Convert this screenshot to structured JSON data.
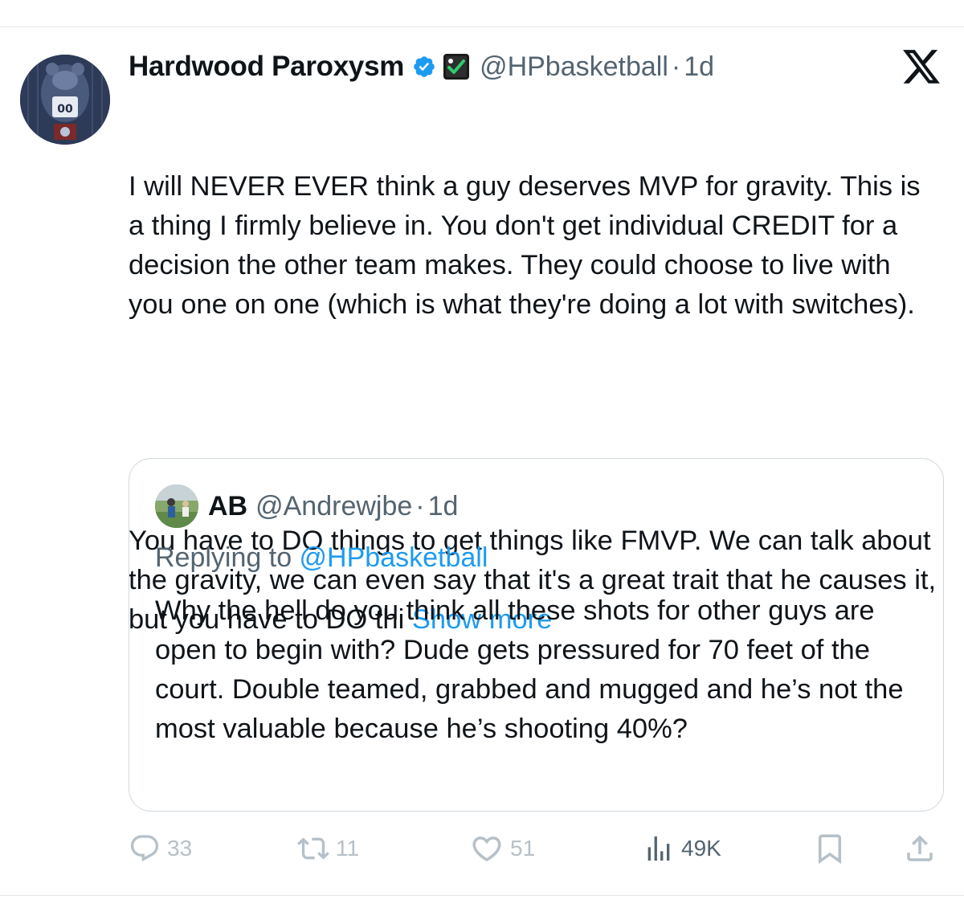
{
  "tweet": {
    "author_name": "Hardwood Paroxysm",
    "handle": "@HPbasketball",
    "separator": "·",
    "time": "1d",
    "text_paragraph_1": "I will NEVER EVER think a guy deserves MVP for gravity. This is a thing I firmly believe in. You don't get individual CREDIT for a decision the other team makes. They could choose to live with you one on one (which is what they're doing a lot with switches).",
    "text_paragraph_2": "You have to DO things to get things like FMVP. We can talk about the gravity, we can even say that it's a great trait that he causes it, but you have to DO thi ",
    "show_more": "Show more"
  },
  "quoted": {
    "author_name": "AB",
    "handle": "@Andrewjbe",
    "separator": "·",
    "time": "1d",
    "replying_prefix": "Replying to ",
    "replying_handle": "@HPbasketball",
    "text": "Why the hell do you think all these shots for other guys are open to begin with? Dude gets pressured for 70 feet of the court. Double teamed, grabbed and mugged and he’s not the most valuable because he’s shooting 40%?"
  },
  "actions": {
    "replies": "33",
    "reposts": "11",
    "likes": "51",
    "views": "49K"
  },
  "icons": {
    "verified": "verified-badge-icon",
    "affiliate": "affiliate-badge-icon",
    "platform": "x-logo-icon",
    "reply": "reply-icon",
    "repost": "repost-icon",
    "like": "heart-icon",
    "views": "views-icon",
    "bookmark": "bookmark-icon",
    "share": "share-icon"
  },
  "colors": {
    "link_blue": "#1d9bf0",
    "secondary_text": "#536471",
    "faded_action": "#b6c0c8",
    "border": "#cfd9de"
  }
}
